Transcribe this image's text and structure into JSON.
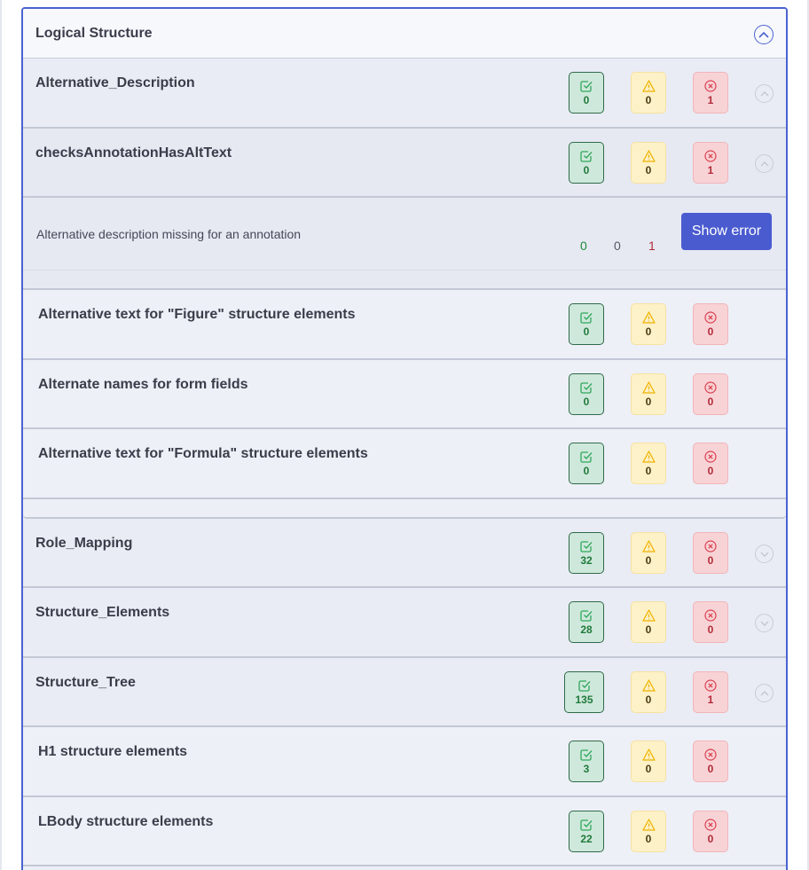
{
  "panel": {
    "title": "Logical Structure"
  },
  "groups": {
    "alt_desc": {
      "label": "Alternative_Description",
      "passed": "0",
      "warnings": "0",
      "failed": "1"
    },
    "role_mapping": {
      "label": "Role_Mapping",
      "passed": "32",
      "warnings": "0",
      "failed": "0"
    },
    "structure_elements": {
      "label": "Structure_Elements",
      "passed": "28",
      "warnings": "0",
      "failed": "0"
    },
    "structure_tree": {
      "label": "Structure_Tree",
      "passed": "135",
      "warnings": "0",
      "failed": "1"
    }
  },
  "checks": {
    "annot_alt": {
      "label": "checksAnnotationHasAltText",
      "passed": "0",
      "warnings": "0",
      "failed": "1",
      "detail": {
        "message": "Alternative description missing for an annotation",
        "passed": "0",
        "warnings": "0",
        "failed": "1",
        "button_label": "Show error"
      }
    }
  },
  "subchecks": {
    "figure": {
      "label": "Alternative text for \"Figure\" structure elements",
      "passed": "0",
      "warnings": "0",
      "failed": "0"
    },
    "form_fields": {
      "label": "Alternate names for form fields",
      "passed": "0",
      "warnings": "0",
      "failed": "0"
    },
    "formula": {
      "label": "Alternative text for \"Formula\" structure elements",
      "passed": "0",
      "warnings": "0",
      "failed": "0"
    },
    "h1": {
      "label": "H1 structure elements",
      "passed": "3",
      "warnings": "0",
      "failed": "0"
    },
    "lbody": {
      "label": "LBody structure elements",
      "passed": "22",
      "warnings": "0",
      "failed": "0"
    }
  },
  "icons": {
    "passed": "check-square-icon",
    "warnings": "warning-triangle-icon",
    "failed": "x-circle-icon",
    "expand": "chevron-down-icon",
    "collapse": "chevron-up-icon"
  },
  "colors": {
    "accent": "#4a5bd0",
    "passed": "#1f8a3a",
    "warning": "#f0b400",
    "failed": "#d9404f"
  }
}
